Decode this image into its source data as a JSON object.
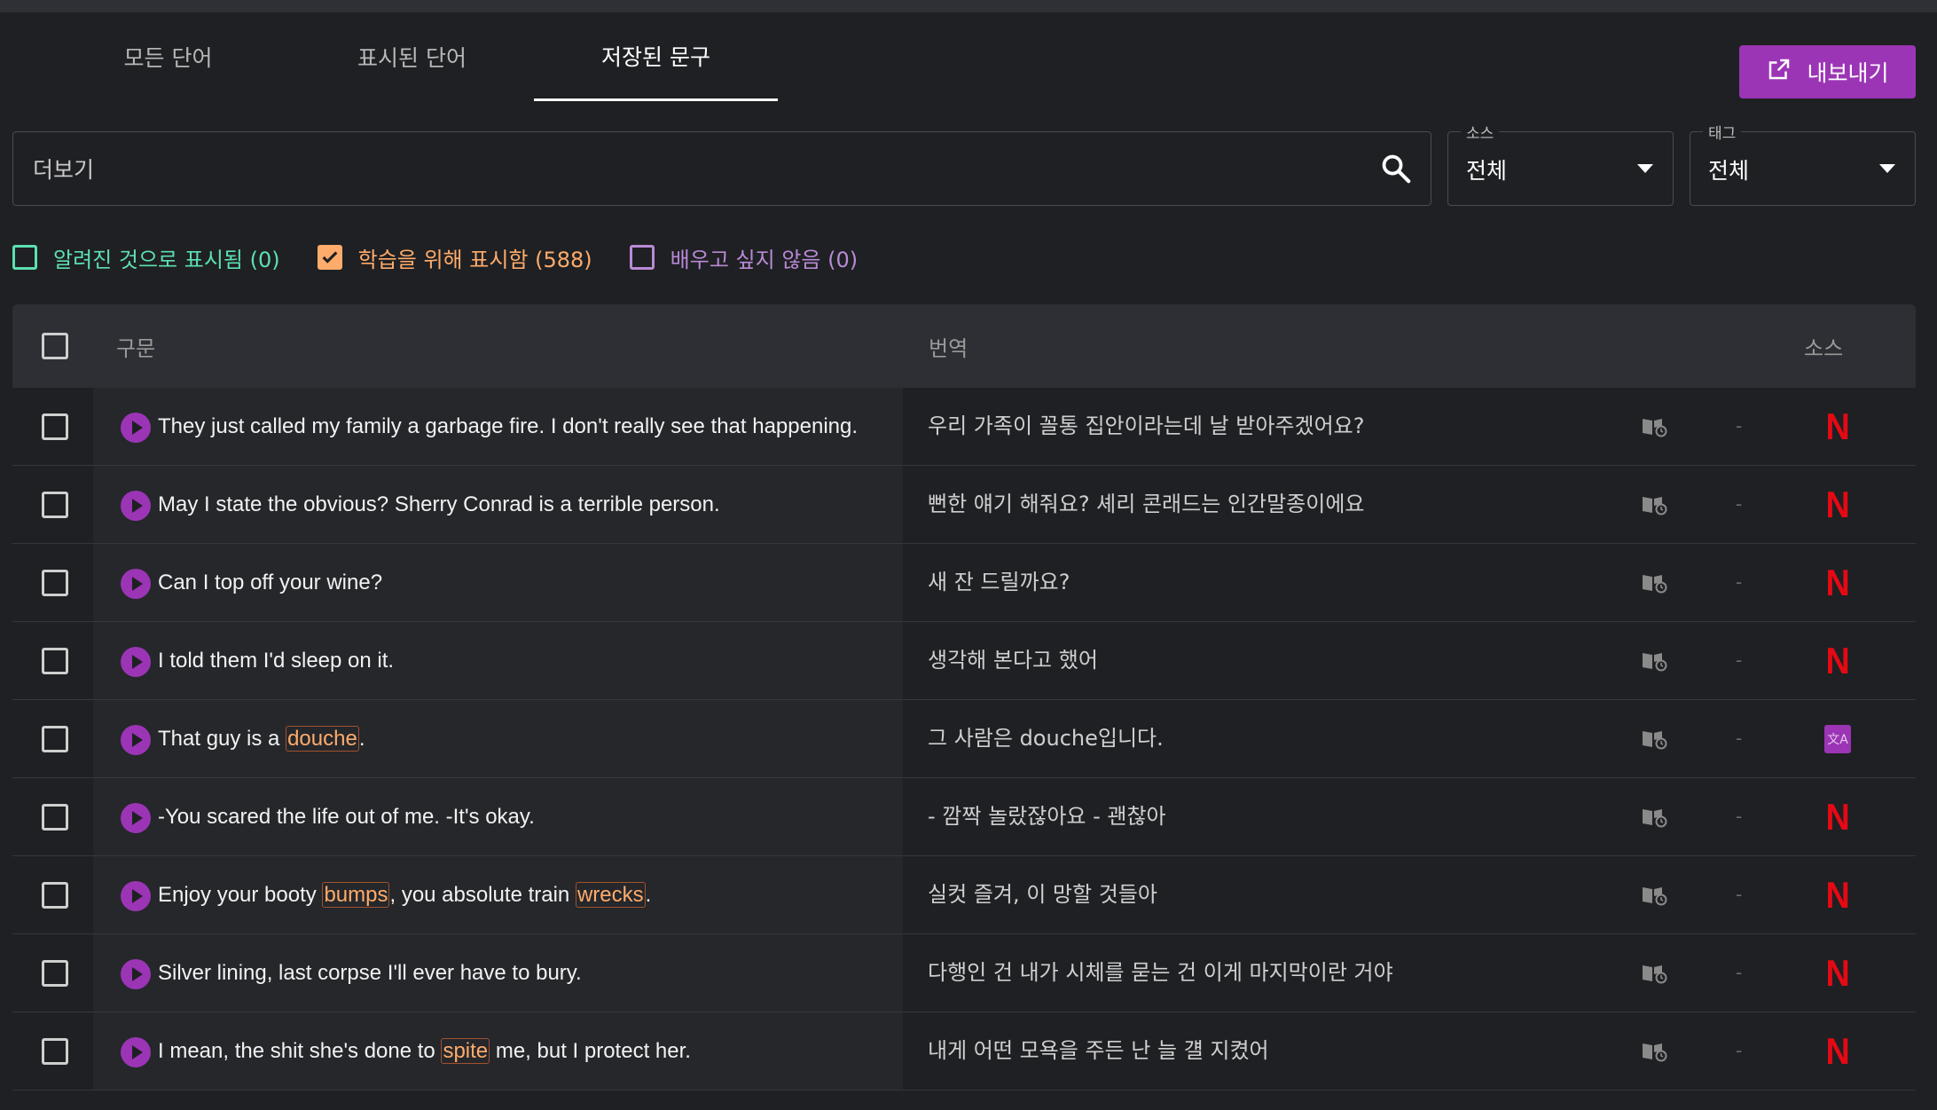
{
  "tabs": [
    {
      "label": "모든 단어",
      "active": false
    },
    {
      "label": "표시된 단어",
      "active": false
    },
    {
      "label": "저장된 문구",
      "active": true
    }
  ],
  "export_label": "내보내기",
  "search": {
    "placeholder": "더보기"
  },
  "source_select": {
    "label": "소스",
    "value": "전체"
  },
  "tag_select": {
    "label": "태그",
    "value": "전체"
  },
  "filters": [
    {
      "label": "알려진 것으로 표시됨 (0)",
      "checked": false,
      "color": "#5ce0b0"
    },
    {
      "label": "학습을 위해 표시함 (588)",
      "checked": true,
      "color": "#ffab6b"
    },
    {
      "label": "배우고 싶지 않음 (0)",
      "checked": false,
      "color": "#b98ad6"
    }
  ],
  "table": {
    "headers": {
      "phrase": "구문",
      "translation": "번역",
      "source": "소스"
    },
    "rows": [
      {
        "parts": [
          {
            "t": "They just called my family a garbage fire. I don't really see that happening."
          }
        ],
        "translation": "우리 가족이 꼴통 집안이라는데 날 받아주겠어요?",
        "tag": "-",
        "source": "netflix",
        "source_glyph": "N"
      },
      {
        "parts": [
          {
            "t": "May I state the obvious? Sherry Conrad is a terrible person."
          }
        ],
        "translation": "뻔한 얘기 해줘요? 셰리 콘래드는 인간말종이에요",
        "tag": "-",
        "source": "netflix",
        "source_glyph": "N"
      },
      {
        "parts": [
          {
            "t": "Can I top off your wine?"
          }
        ],
        "translation": "새 잔 드릴까요?",
        "tag": "-",
        "source": "netflix",
        "source_glyph": "N"
      },
      {
        "parts": [
          {
            "t": "I told them I'd sleep on it."
          }
        ],
        "translation": "생각해 본다고 했어",
        "tag": "-",
        "source": "netflix",
        "source_glyph": "N"
      },
      {
        "parts": [
          {
            "t": "That guy is a "
          },
          {
            "t": "douche",
            "hl": true
          },
          {
            "t": "."
          }
        ],
        "translation": "그 사람은 douche입니다.",
        "tag": "-",
        "source": "translate",
        "source_glyph": "文A"
      },
      {
        "parts": [
          {
            "t": "-You scared the life out of me. -It's okay."
          }
        ],
        "translation": "- 깜짝 놀랐잖아요 - 괜찮아",
        "tag": "-",
        "source": "netflix",
        "source_glyph": "N"
      },
      {
        "parts": [
          {
            "t": "Enjoy your booty "
          },
          {
            "t": "bumps",
            "hl": true
          },
          {
            "t": ", you absolute train "
          },
          {
            "t": "wrecks",
            "hl": true
          },
          {
            "t": "."
          }
        ],
        "translation": "실컷 즐겨, 이 망할 것들아",
        "tag": "-",
        "source": "netflix",
        "source_glyph": "N"
      },
      {
        "parts": [
          {
            "t": "Silver lining, last corpse I'll ever have to bury."
          }
        ],
        "translation": "다행인 건 내가 시체를 묻는 건 이게 마지막이란 거야",
        "tag": "-",
        "source": "netflix",
        "source_glyph": "N"
      },
      {
        "parts": [
          {
            "t": "I mean, the shit she's done to "
          },
          {
            "t": "spite",
            "hl": true
          },
          {
            "t": " me, but I protect her."
          }
        ],
        "translation": "내게 어떤 모욕을 주든 난 늘 걜 지켰어",
        "tag": "-",
        "source": "netflix",
        "source_glyph": "N"
      }
    ]
  },
  "colors": {
    "accent": "#9b35b5",
    "highlight": "#ffab6b",
    "netflix": "#e50914"
  }
}
